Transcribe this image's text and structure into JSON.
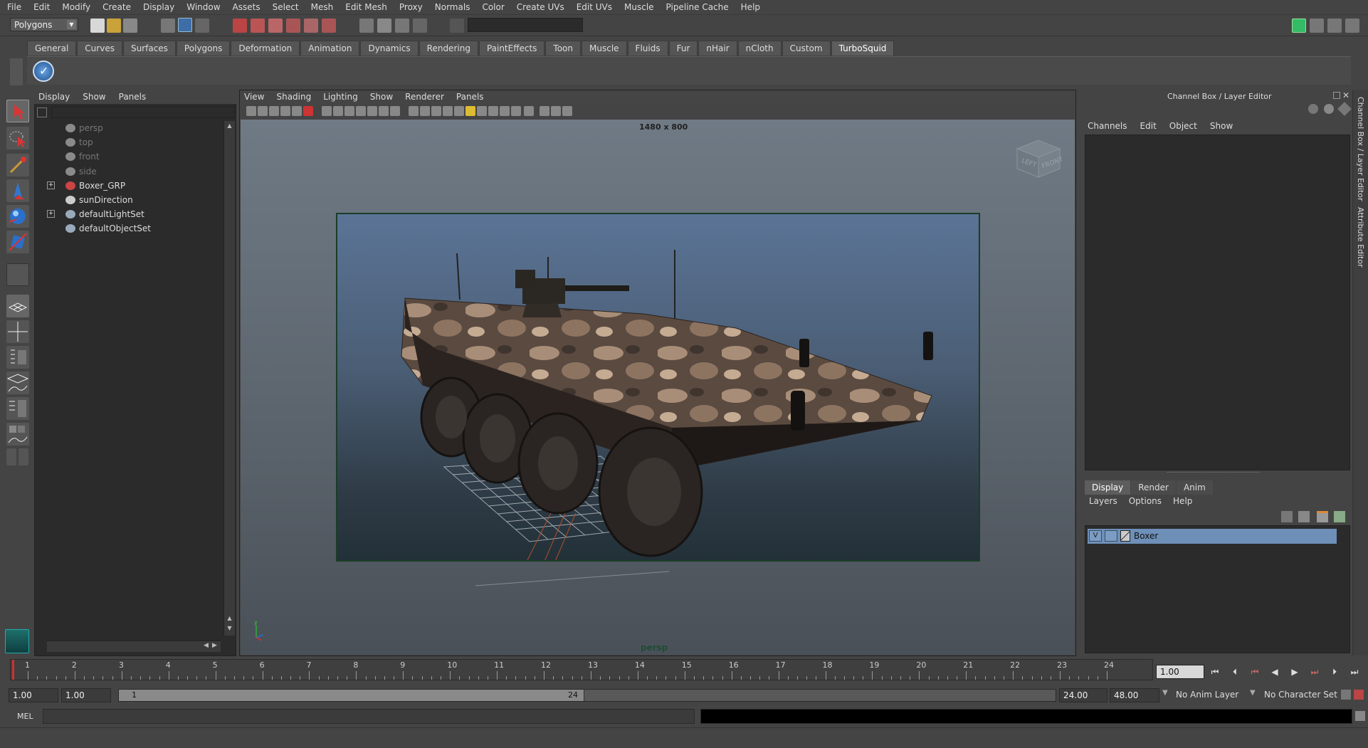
{
  "menubar": [
    "File",
    "Edit",
    "Modify",
    "Create",
    "Display",
    "Window",
    "Assets",
    "Select",
    "Mesh",
    "Edit Mesh",
    "Proxy",
    "Normals",
    "Color",
    "Create UVs",
    "Edit UVs",
    "Muscle",
    "Pipeline Cache",
    "Help"
  ],
  "statusline": {
    "mode": "Polygons"
  },
  "shelf": {
    "tabs": [
      "General",
      "Curves",
      "Surfaces",
      "Polygons",
      "Deformation",
      "Animation",
      "Dynamics",
      "Rendering",
      "PaintEffects",
      "Toon",
      "Muscle",
      "Fluids",
      "Fur",
      "nHair",
      "nCloth",
      "Custom",
      "TurboSquid"
    ],
    "active_tab": "TurboSquid"
  },
  "outliner": {
    "menu": [
      "Display",
      "Show",
      "Panels"
    ],
    "items": [
      {
        "label": "persp",
        "expandable": false,
        "dim": true,
        "icon": "camera-icon"
      },
      {
        "label": "top",
        "expandable": false,
        "dim": true,
        "icon": "camera-icon"
      },
      {
        "label": "front",
        "expandable": false,
        "dim": true,
        "icon": "camera-icon"
      },
      {
        "label": "side",
        "expandable": false,
        "dim": true,
        "icon": "camera-icon"
      },
      {
        "label": "Boxer_GRP",
        "expandable": true,
        "dim": false,
        "icon": "group-icon"
      },
      {
        "label": "sunDirection",
        "expandable": false,
        "dim": false,
        "icon": "light-icon"
      },
      {
        "label": "defaultLightSet",
        "expandable": true,
        "dim": false,
        "icon": "set-icon"
      },
      {
        "label": "defaultObjectSet",
        "expandable": false,
        "dim": false,
        "icon": "set-icon"
      }
    ]
  },
  "viewport": {
    "menu": [
      "View",
      "Shading",
      "Lighting",
      "Show",
      "Renderer",
      "Panels"
    ],
    "resolution": "1480 x 800",
    "camera": "persp",
    "viewcube_faces": [
      "LEFT",
      "FRONT"
    ]
  },
  "channel_box": {
    "title": "Channel Box / Layer Editor",
    "menu": [
      "Channels",
      "Edit",
      "Object",
      "Show"
    ]
  },
  "layer_editor": {
    "tabs": [
      "Display",
      "Render",
      "Anim"
    ],
    "active_tab": "Display",
    "menu": [
      "Layers",
      "Options",
      "Help"
    ],
    "layers": [
      {
        "visible": "V",
        "name": "Boxer"
      }
    ]
  },
  "side_tabs": [
    "Channel Box / Layer Editor",
    "Attribute Editor"
  ],
  "timeline": {
    "ticks": [
      "1",
      "2",
      "3",
      "4",
      "5",
      "6",
      "7",
      "8",
      "9",
      "10",
      "11",
      "12",
      "13",
      "14",
      "15",
      "16",
      "17",
      "18",
      "19",
      "20",
      "21",
      "22",
      "23",
      "24"
    ],
    "current_frame": "1.00"
  },
  "range": {
    "start": "1.00",
    "playback_start": "1.00",
    "range_start_label": "1",
    "range_end_label": "24",
    "playback_end": "24.00",
    "end": "48.00",
    "anim_layer": "No Anim Layer",
    "character_set": "No Character Set"
  },
  "command_line": {
    "label": "MEL"
  },
  "colors": {
    "ui_bg": "#444444",
    "panel_dark": "#2b2b2b",
    "selection": "#6e90b8",
    "frame_border": "#1a3d28"
  }
}
